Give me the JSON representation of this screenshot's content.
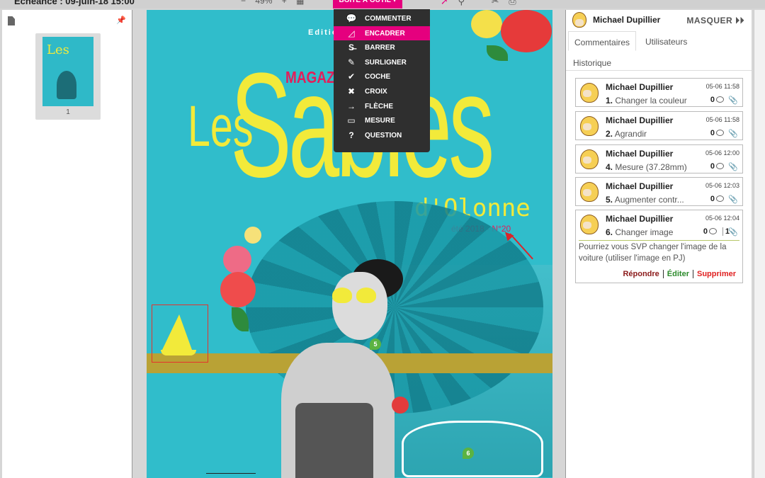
{
  "header": {
    "deadline": "Echéance : 09-juin-18 15:00",
    "zoom_minus": "−",
    "zoom_value": "49%",
    "zoom_plus": "+",
    "toolbox_label": "BOÎTE À OUTIL ▾"
  },
  "thumbnail": {
    "page_number": "1"
  },
  "magazine": {
    "edition": "Editio",
    "magazine_label": "MAGAZINE",
    "title_les": "Les",
    "title_sables": "Sables",
    "title_olonne": "d'Olonne",
    "issue": "été 2018 · N°20",
    "pin5": "5",
    "pin6": "6"
  },
  "menu": {
    "items": [
      {
        "label": "COMMENTER",
        "icon": "speech-bubble-icon",
        "glyph": "💬"
      },
      {
        "label": "ENCADRER",
        "icon": "frame-icon",
        "glyph": "◿"
      },
      {
        "label": "BARRER",
        "icon": "strikethrough-icon",
        "glyph": "S̶"
      },
      {
        "label": "SURLIGNER",
        "icon": "highlighter-icon",
        "glyph": "✎"
      },
      {
        "label": "COCHE",
        "icon": "checkmark-icon",
        "glyph": "✔"
      },
      {
        "label": "CROIX",
        "icon": "cross-icon",
        "glyph": "✖"
      },
      {
        "label": "FLÈCHE",
        "icon": "arrow-icon",
        "glyph": "→"
      },
      {
        "label": "MESURE",
        "icon": "ruler-icon",
        "glyph": "▭"
      },
      {
        "label": "QUESTION",
        "icon": "question-icon",
        "glyph": "?"
      }
    ],
    "active": "ENCADRER"
  },
  "panel": {
    "user": "Michael Dupillier",
    "hide_label": "MASQUER ⏵⏵",
    "tabs": [
      "Commentaires",
      "Utilisateurs",
      "Historique"
    ]
  },
  "comments": [
    {
      "author": "Michael Dupillier",
      "date": "05-06 11:58",
      "num": "1.",
      "title": "Changer la couleur",
      "count": "0"
    },
    {
      "author": "Michael Dupillier",
      "date": "05-06 11:58",
      "num": "2.",
      "title": "Agrandir",
      "count": "0"
    },
    {
      "author": "Michael Dupillier",
      "date": "05-06 12:00",
      "num": "4.",
      "title": "Mesure (37.28mm)",
      "count": "0"
    },
    {
      "author": "Michael Dupillier",
      "date": "05-06 12:03",
      "num": "5.",
      "title": "Augmenter contr...",
      "count": "0"
    },
    {
      "author": "Michael Dupillier",
      "date": "05-06 12:04",
      "num": "6.",
      "title": "Changer image",
      "count": "0",
      "attachments": "1",
      "body": "Pourriez vous SVP changer l'image de la voiture (utiliser l'image en PJ)",
      "actions": {
        "reply": "Répondre",
        "edit": "Éditer",
        "delete": "Supprimer"
      }
    }
  ],
  "colors": {
    "accent": "#e5007e",
    "page_bg": "#30bdcb",
    "title_yellow": "#f2ea3a",
    "magazine_red": "#e31d5a"
  }
}
